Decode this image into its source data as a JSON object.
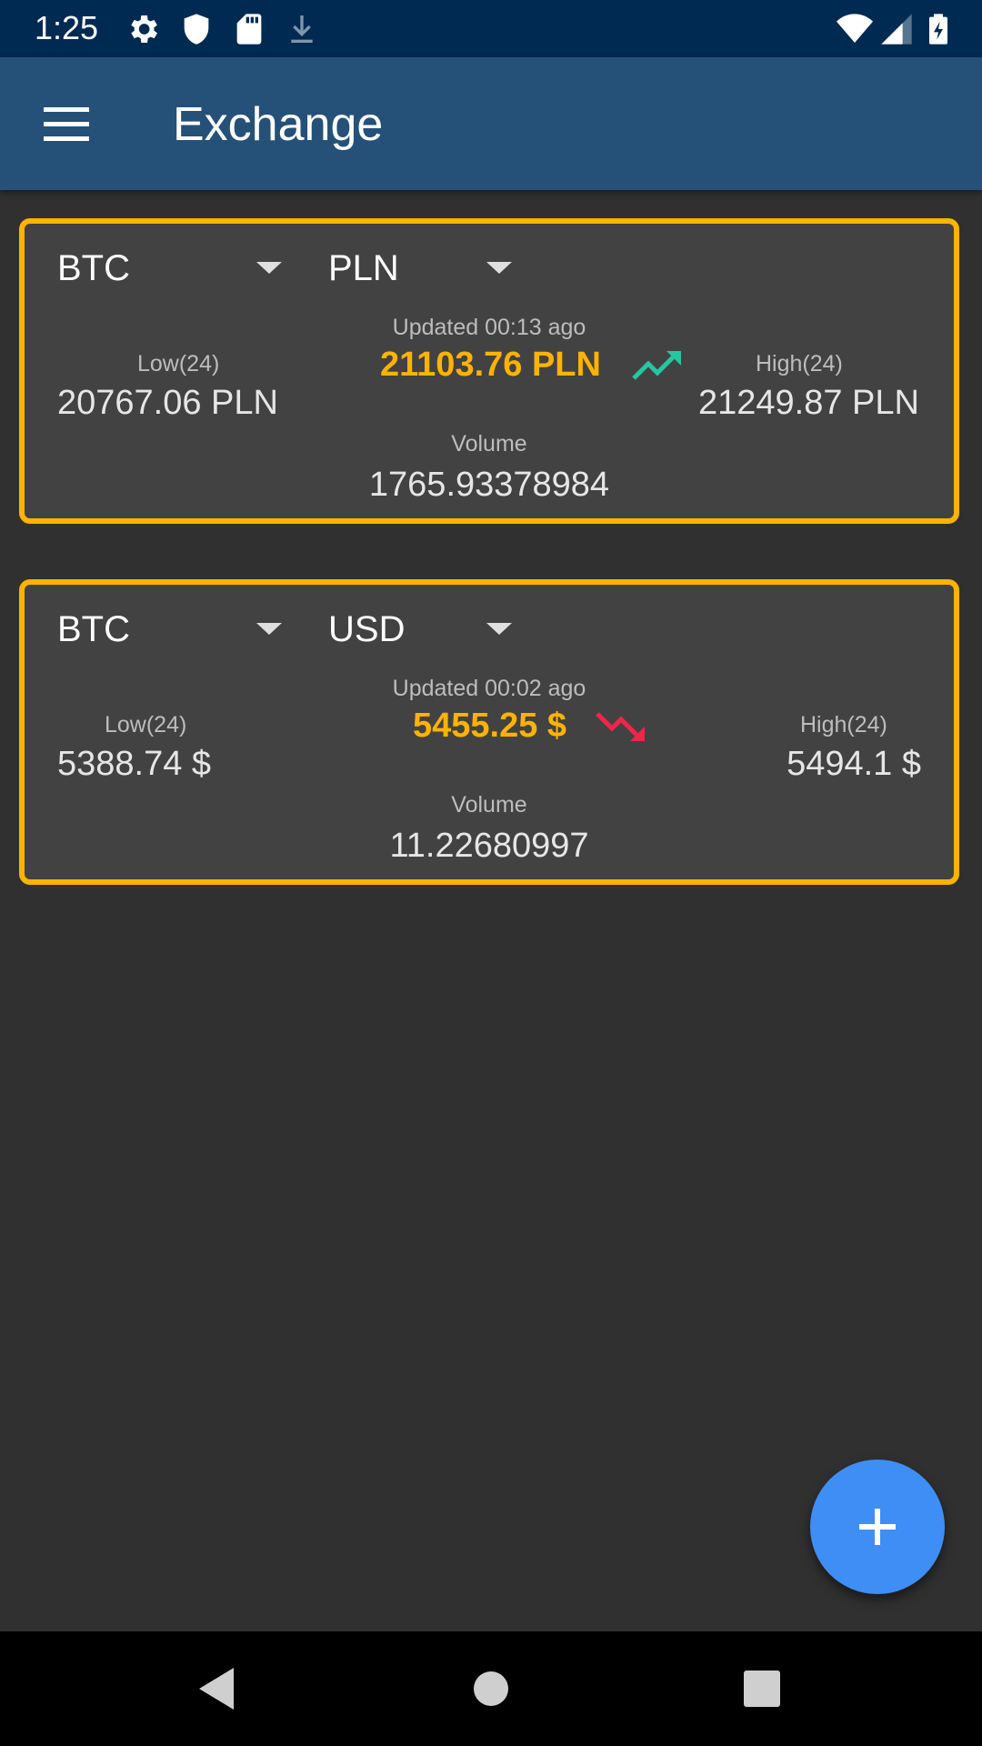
{
  "status_bar": {
    "time": "1:25",
    "icons": [
      "gear-icon",
      "shield-icon",
      "sd-card-icon",
      "download-icon",
      "wifi-icon",
      "signal-icon",
      "battery-charging-icon"
    ]
  },
  "app_bar": {
    "title": "Exchange",
    "menu_icon": "hamburger-menu-icon"
  },
  "cards": [
    {
      "base": "BTC",
      "quote": "PLN",
      "updated": "Updated 00:13 ago",
      "low_label": "Low(24)",
      "low_value": "20767.06 PLN",
      "price": "21103.76 PLN",
      "trend": "up",
      "high_label": "High(24)",
      "high_value": "21249.87 PLN",
      "volume_label": "Volume",
      "volume_value": "1765.93378984"
    },
    {
      "base": "BTC",
      "quote": "USD",
      "updated": "Updated 00:02 ago",
      "low_label": "Low(24)",
      "low_value": "5388.74 $",
      "price": "5455.25 $",
      "trend": "down",
      "high_label": "High(24)",
      "high_value": "5494.1 $",
      "volume_label": "Volume",
      "volume_value": "11.22680997"
    }
  ],
  "colors": {
    "accent": "#ffb300",
    "up": "#26c6a0",
    "down": "#f0254a",
    "fab": "#3f8ef5",
    "appbar": "#255179",
    "statusbar": "#002a52"
  },
  "fab": {
    "icon": "plus-icon"
  },
  "nav_bar": {
    "icons": [
      "back-icon",
      "home-icon",
      "recents-icon"
    ]
  }
}
